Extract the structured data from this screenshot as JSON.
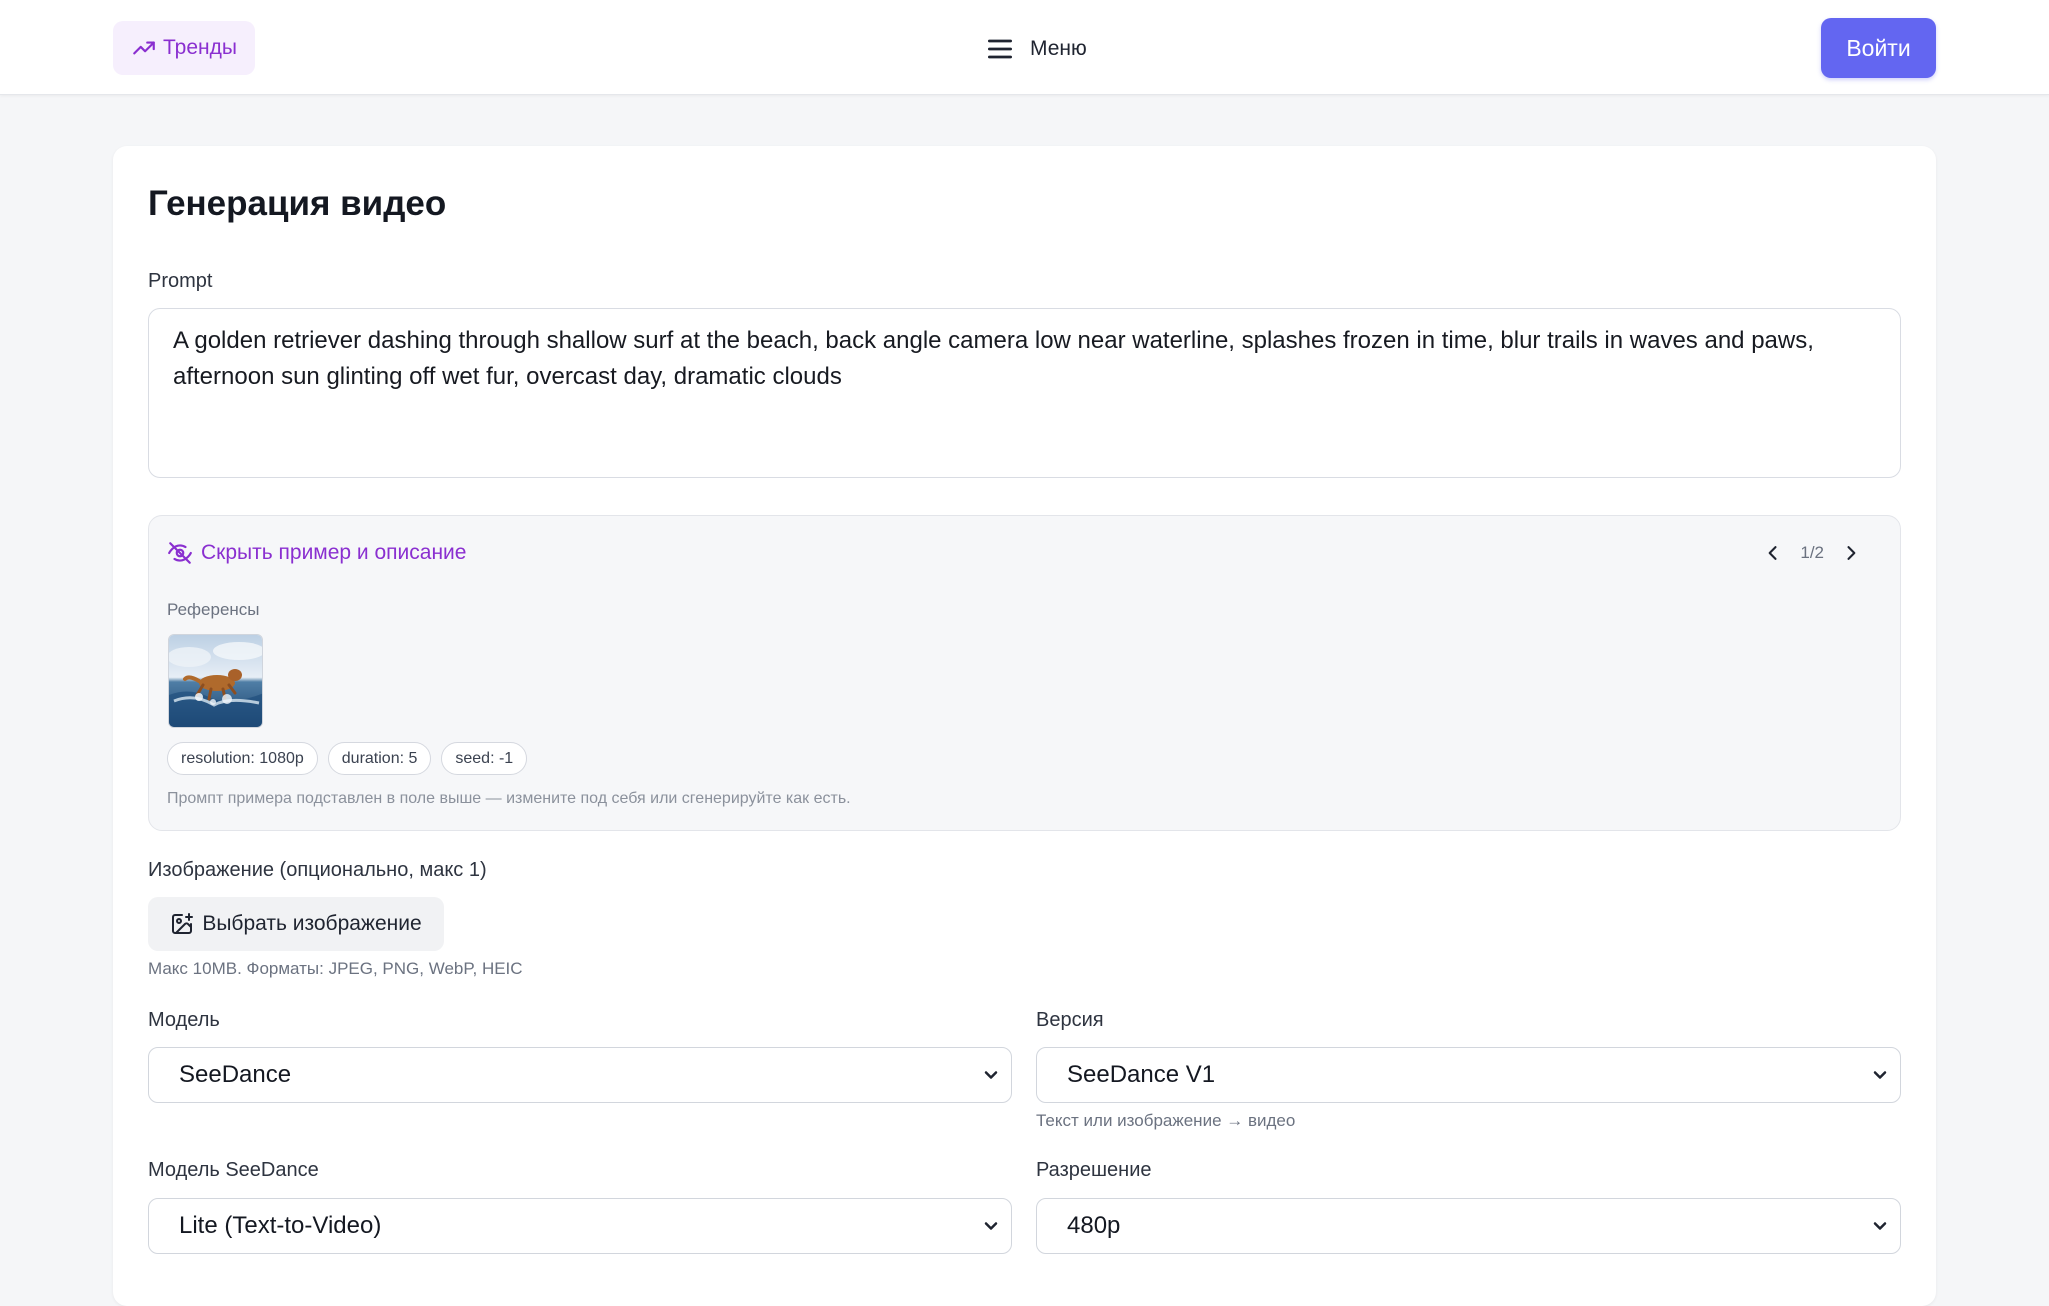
{
  "header": {
    "trends_label": "Тренды",
    "menu_label": "Меню",
    "login_label": "Войти"
  },
  "page": {
    "title": "Генерация видео",
    "prompt_label": "Prompt",
    "prompt_value": "A golden retriever dashing through shallow surf at the beach, back angle camera low near waterline, splashes frozen in time, blur trails in waves and paws, afternoon sun glinting off wet fur, overcast day, dramatic clouds"
  },
  "example": {
    "toggle_label": "Скрыть пример и описание",
    "pager": "1/2",
    "references_label": "Референсы",
    "chips": [
      "resolution: 1080p",
      "duration: 5",
      "seed: -1"
    ],
    "note": "Промпт примера подставлен в поле выше — измените под себя или сгенерируйте как есть."
  },
  "upload": {
    "label": "Изображение (опционально, макс 1)",
    "button_label": "Выбрать изображение",
    "hint": "Макс 10MB. Форматы: JPEG, PNG, WebP, HEIC"
  },
  "fields": {
    "model_label": "Модель",
    "model_value": "SeeDance",
    "version_label": "Версия",
    "version_value": "SeeDance V1",
    "version_hint": "Текст или изображение → видео",
    "seedance_model_label": "Модель SeeDance",
    "seedance_model_value": "Lite (Text-to-Video)",
    "resolution_label": "Разрешение",
    "resolution_value": "480p"
  },
  "icons": {
    "trends": "trending-up-icon",
    "menu": "hamburger-icon",
    "hide": "eye-off-icon",
    "upload": "image-plus-icon"
  },
  "colors": {
    "accent_purple": "#8a2fd0",
    "primary_button": "#6366f1",
    "page_bg": "#f5f6f8"
  }
}
